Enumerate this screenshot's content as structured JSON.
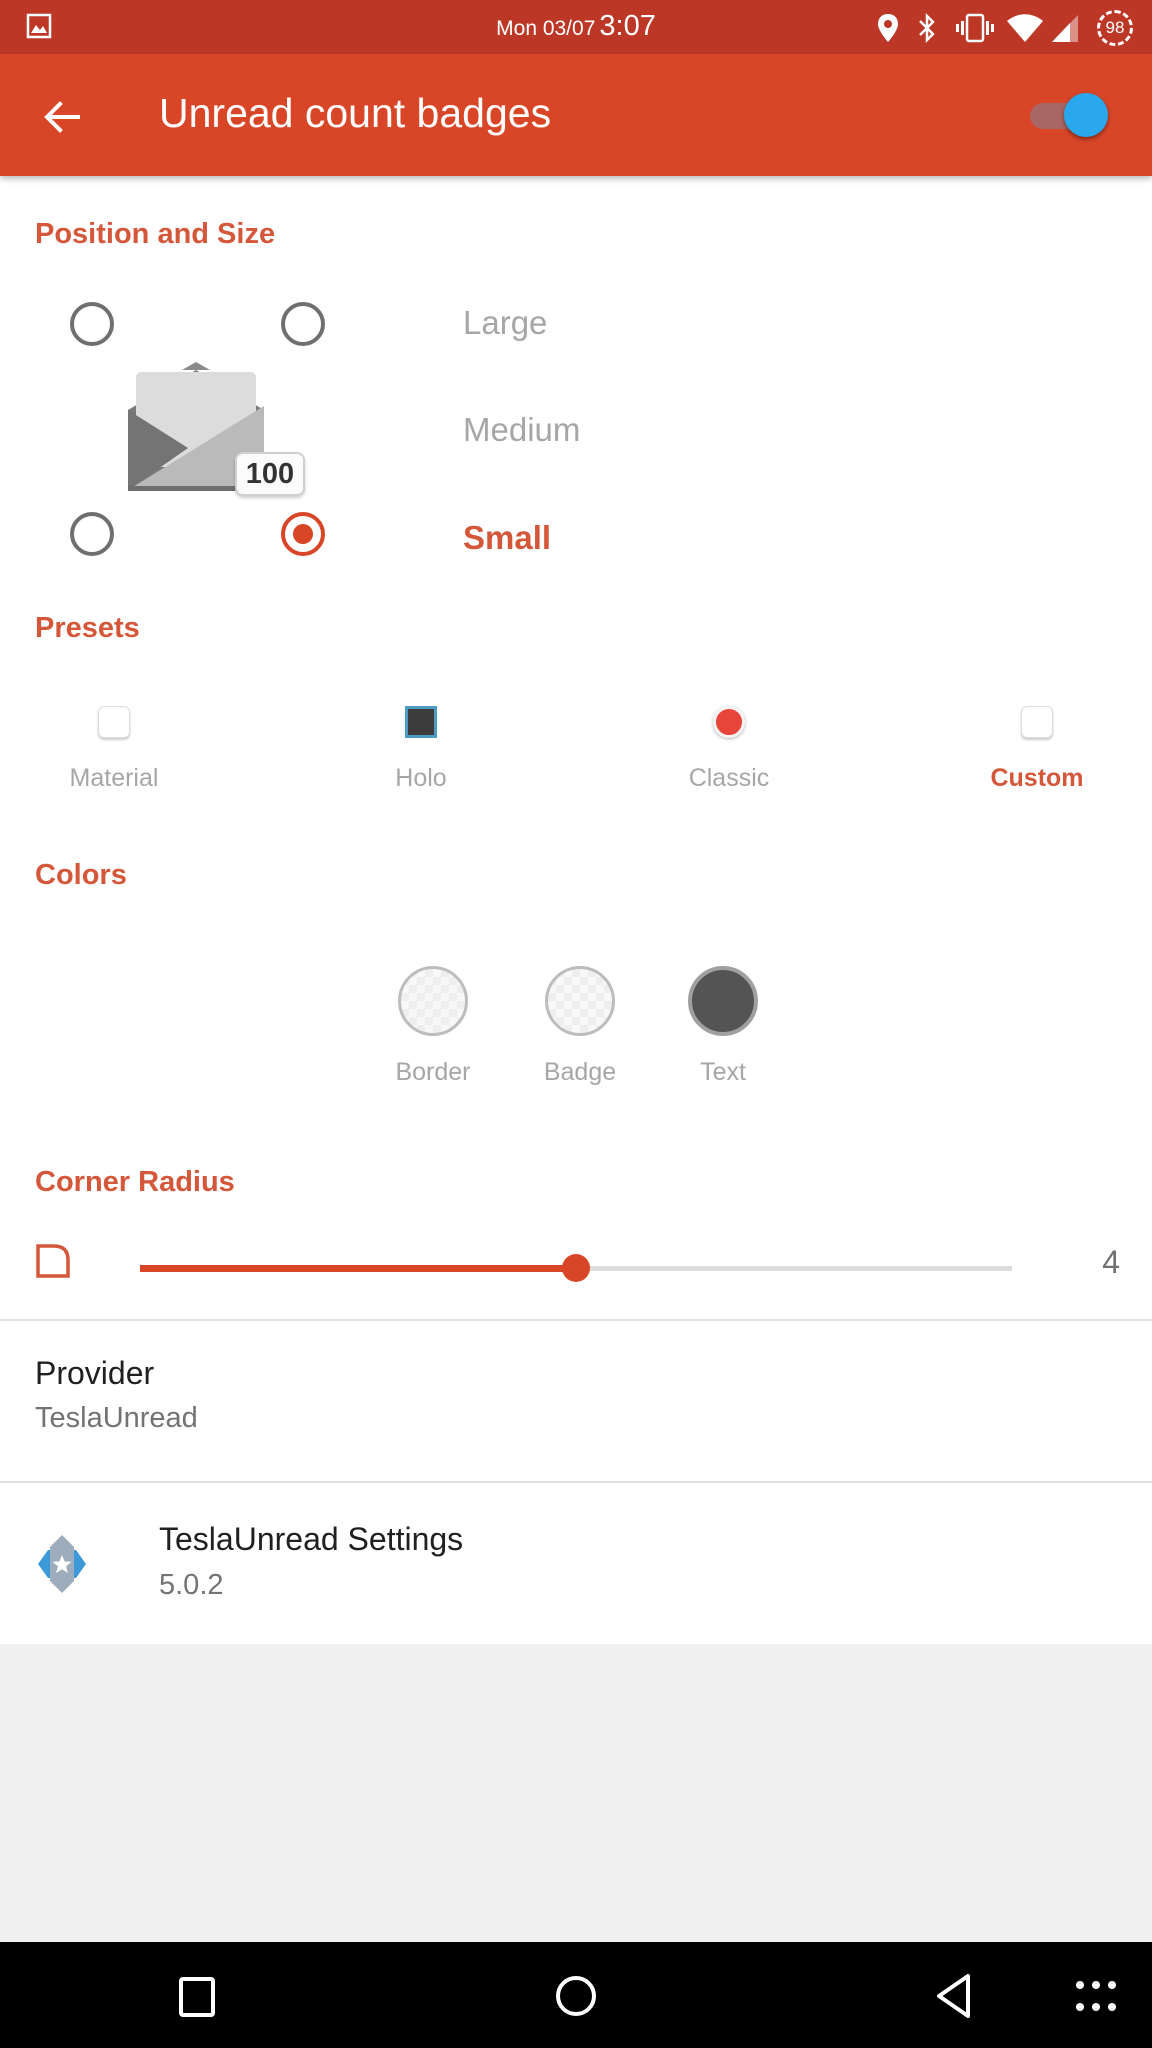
{
  "status_bar": {
    "date": "Mon 03/07",
    "time": "3:07",
    "battery_level": "98",
    "icons": [
      "image-notification-icon",
      "location-icon",
      "bluetooth-icon",
      "vibrate-icon",
      "wifi-icon",
      "cell-signal-icon",
      "battery-icon"
    ]
  },
  "app_bar": {
    "title": "Unread count badges",
    "back_icon": "arrow-back-icon",
    "master_toggle_on": true
  },
  "position_and_size": {
    "title": "Position and Size",
    "positions": [
      {
        "id": "top-left",
        "selected": false
      },
      {
        "id": "top-right",
        "selected": false
      },
      {
        "id": "bottom-left",
        "selected": false
      },
      {
        "id": "bottom-right",
        "selected": true
      }
    ],
    "preview_badge_count": "100",
    "sizes": [
      {
        "label": "Large",
        "selected": false
      },
      {
        "label": "Medium",
        "selected": false
      },
      {
        "label": "Small",
        "selected": true
      }
    ]
  },
  "presets": {
    "title": "Presets",
    "items": [
      {
        "label": "Material",
        "selected": false,
        "color": "#ffffff"
      },
      {
        "label": "Holo",
        "selected": false,
        "color": "#3c3c3c",
        "border_color": "#4a9cc4"
      },
      {
        "label": "Classic",
        "selected": false,
        "color": "#e8443a"
      },
      {
        "label": "Custom",
        "selected": true,
        "color": "#ffffff"
      }
    ]
  },
  "colors": {
    "title": "Colors",
    "items": [
      {
        "label": "Border",
        "value": "transparent"
      },
      {
        "label": "Badge",
        "value": "transparent"
      },
      {
        "label": "Text",
        "value": "#545454"
      }
    ]
  },
  "corner_radius": {
    "title": "Corner Radius",
    "value": "4",
    "fraction": 0.5
  },
  "provider": {
    "title": "Provider",
    "value": "TeslaUnread"
  },
  "tesla_settings": {
    "title": "TeslaUnread Settings",
    "version": "5.0.2"
  },
  "nav_bar": {
    "buttons": [
      "recents",
      "home",
      "back",
      "app-drawer"
    ]
  },
  "theme": {
    "accent": "#d84627",
    "status_bar": "#bc3726",
    "toggle_thumb": "#2aa8ee"
  }
}
